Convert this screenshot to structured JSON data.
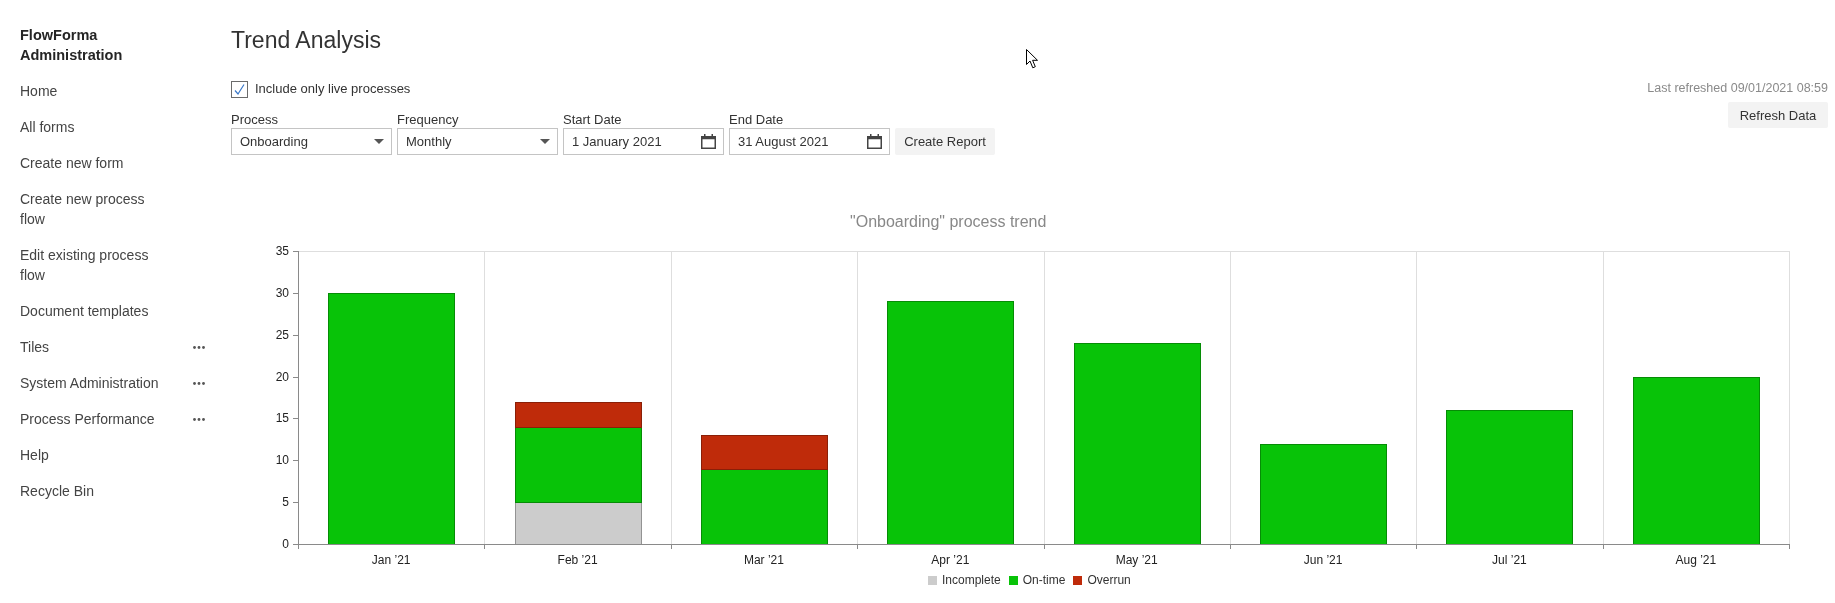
{
  "sidebar": {
    "title": "FlowForma Administration",
    "items": [
      {
        "label": "Home",
        "has_more": false
      },
      {
        "label": "All forms",
        "has_more": false
      },
      {
        "label": "Create new form",
        "has_more": false
      },
      {
        "label": "Create new process flow",
        "has_more": false
      },
      {
        "label": "Edit existing process flow",
        "has_more": false
      },
      {
        "label": "Document templates",
        "has_more": false
      },
      {
        "label": "Tiles",
        "has_more": true
      },
      {
        "label": "System Administration",
        "has_more": true
      },
      {
        "label": "Process Performance",
        "has_more": true
      },
      {
        "label": "Help",
        "has_more": false
      },
      {
        "label": "Recycle Bin",
        "has_more": false
      }
    ]
  },
  "header": {
    "title": "Trend Analysis",
    "last_refreshed": "Last refreshed 09/01/2021 08:59",
    "refresh_button": "Refresh Data"
  },
  "live_only": {
    "label": "Include only live processes",
    "checked": true
  },
  "filters": [
    {
      "kind": "dropdown",
      "label": "Process",
      "value": "Onboarding"
    },
    {
      "kind": "dropdown",
      "label": "Frequency",
      "value": "Monthly"
    },
    {
      "kind": "date",
      "label": "Start Date",
      "value": "1 January 2021"
    },
    {
      "kind": "date",
      "label": "End Date",
      "value": "31 August 2021"
    }
  ],
  "create_button": "Create Report",
  "chart": {
    "chart_data": {
      "type": "bar",
      "title": "\"Onboarding\" process trend",
      "categories": [
        "Jan ’21",
        "Feb ’21",
        "Mar ’21",
        "Apr ’21",
        "May ’21",
        "Jun ’21",
        "Jul ’21",
        "Aug ’21"
      ],
      "stacked": true,
      "legend": "bottom",
      "ylim": [
        0,
        35
      ],
      "yticks": [
        0,
        5,
        10,
        15,
        20,
        25,
        30,
        35
      ],
      "series": [
        {
          "name": "Incomplete",
          "color": "#cccccc",
          "values": [
            0,
            5,
            0,
            0,
            0,
            0,
            0,
            0
          ]
        },
        {
          "name": "On-time",
          "color": "#08c308",
          "values": [
            30,
            9,
            9,
            29,
            24,
            12,
            16,
            20
          ]
        },
        {
          "name": "Overrun",
          "color": "#bf2b0a",
          "values": [
            0,
            3,
            4,
            0,
            0,
            0,
            0,
            0
          ]
        }
      ]
    }
  }
}
